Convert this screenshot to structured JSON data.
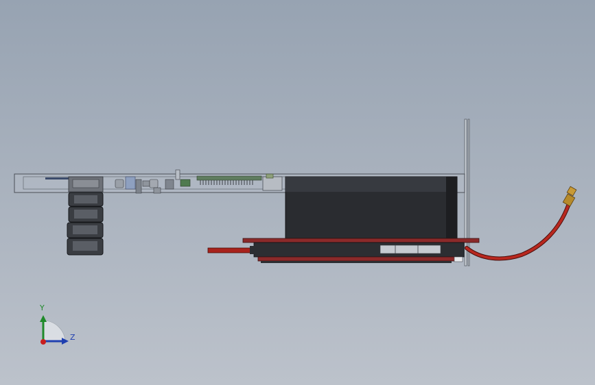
{
  "viewport": {
    "background_top": "#97a3b2",
    "background_bottom": "#bcc2cb"
  },
  "triad": {
    "axis_y": {
      "label": "Y",
      "color": "#1f8a2a"
    },
    "axis_z": {
      "label": "Z",
      "color": "#1f3fb0"
    },
    "origin_color": "#c81e1e"
  },
  "model": {
    "view": "side",
    "colors": {
      "chassis_outline": "#4a4f57",
      "chassis_fill": "#b9c0c9",
      "heatsink": "#2a2c30",
      "pcb": "#8b2a2a",
      "cable": "#a8221c",
      "connector_brass": "#b68a2a",
      "frame_bracket": "#8d949c"
    }
  }
}
